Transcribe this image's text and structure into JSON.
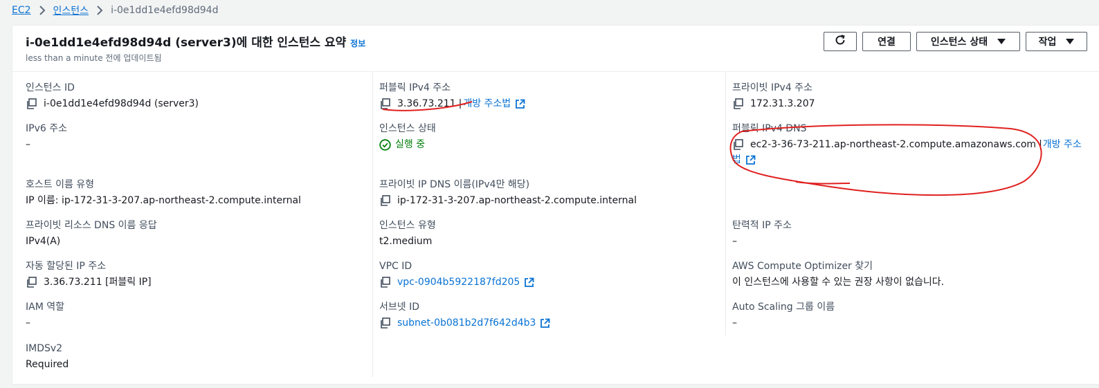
{
  "breadcrumb": {
    "items": [
      "EC2",
      "인스턴스"
    ],
    "current": "i-0e1dd1e4efd98d94d"
  },
  "header": {
    "title": "i-0e1dd1e4efd98d94d (server3)에 대한 인스턴스 요약",
    "info": "정보",
    "updated": "less than a minute 전에 업데이트됨"
  },
  "actions": {
    "refresh_icon": "refresh-icon",
    "connect": "연결",
    "instance_state": "인스턴스 상태",
    "actions": "작업"
  },
  "fields": {
    "instance_id": {
      "label": "인스턴스 ID",
      "value": "i-0e1dd1e4efd98d94d (server3)"
    },
    "ipv6": {
      "label": "IPv6 주소",
      "value": "–"
    },
    "hostname_type": {
      "label": "호스트 이름 유형",
      "value": "IP 이름: ip-172-31-3-207.ap-northeast-2.compute.internal"
    },
    "private_dns_answer": {
      "label": "프라이빗 리소스 DNS 이름 응답",
      "value": "IPv4(A)"
    },
    "auto_ip": {
      "label": "자동 할당된 IP 주소",
      "value": "3.36.73.211 [퍼블릭 IP]"
    },
    "iam_role": {
      "label": "IAM 역할",
      "value": "–"
    },
    "imdsv2": {
      "label": "IMDSv2",
      "value": "Required"
    },
    "public_ipv4": {
      "label": "퍼블릭 IPv4 주소",
      "value": "3.36.73.211",
      "sep": "|",
      "link": "개방 주소법"
    },
    "instance_state": {
      "label": "인스턴스 상태",
      "value": "실행 중"
    },
    "private_ip_dns": {
      "label": "프라이빗 IP DNS 이름(IPv4만 해당)",
      "value": "ip-172-31-3-207.ap-northeast-2.compute.internal"
    },
    "instance_type": {
      "label": "인스턴스 유형",
      "value": "t2.medium"
    },
    "vpc_id": {
      "label": "VPC ID",
      "value": "vpc-0904b5922187fd205"
    },
    "subnet_id": {
      "label": "서브넷 ID",
      "value": "subnet-0b081b2d7f642d4b3"
    },
    "private_ipv4": {
      "label": "프라이빗 IPv4 주소",
      "value": "172.31.3.207"
    },
    "public_dns": {
      "label": "퍼블릭 IPv4 DNS",
      "value": "ec2-3-36-73-211.ap-northeast-2.compute.amazonaws.com",
      "sep": "|",
      "link_a": "개방 주소",
      "link_b": "법"
    },
    "elastic_ip": {
      "label": "탄력적 IP 주소",
      "value": "–"
    },
    "optimizer": {
      "label": "AWS Compute Optimizer 찾기",
      "value": "이 인스턴스에 사용할 수 있는 권장 사항이 없습니다."
    },
    "asg": {
      "label": "Auto Scaling 그룹 이름",
      "value": "–"
    }
  },
  "colors": {
    "link": "#0972d3",
    "success": "#037f0c",
    "annotation": "#e0201e"
  }
}
